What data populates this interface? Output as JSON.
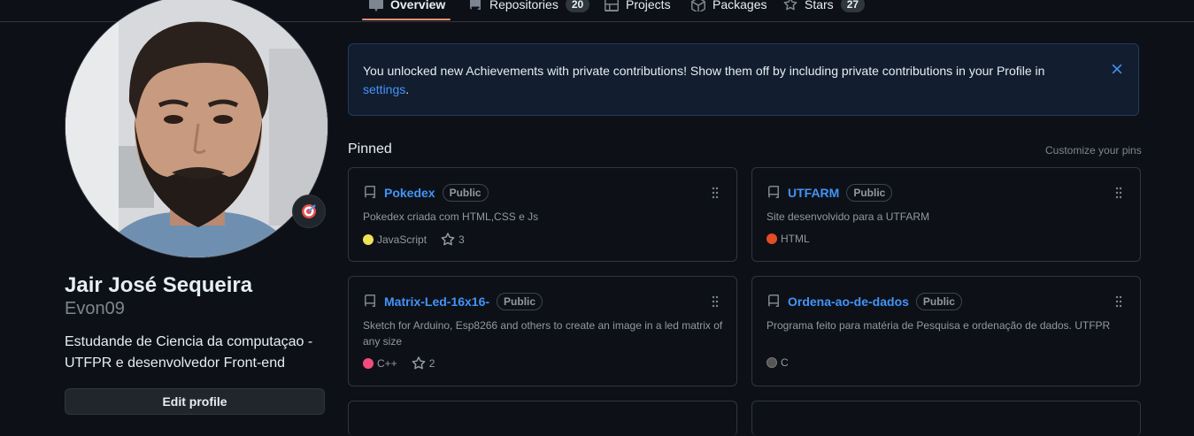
{
  "nav": {
    "tabs": [
      {
        "label": "Overview",
        "icon": "book-icon",
        "selected": true
      },
      {
        "label": "Repositories",
        "icon": "repo-icon",
        "count": "20"
      },
      {
        "label": "Projects",
        "icon": "table-icon"
      },
      {
        "label": "Packages",
        "icon": "package-icon"
      },
      {
        "label": "Stars",
        "icon": "star-icon",
        "count": "27"
      }
    ]
  },
  "profile": {
    "full_name": "Jair José Sequeira",
    "username": "Evon09",
    "bio": "Estudande de Ciencia da computaçao - UTFPR e desenvolvedor Front-end",
    "edit_label": "Edit profile",
    "status_icon": "target-emoji-icon"
  },
  "banner": {
    "text": "You unlocked new Achievements with private contributions! Show them off by including private contributions in your Profile in ",
    "link": "settings",
    "end": "."
  },
  "pinned": {
    "title": "Pinned",
    "customize": "Customize your pins",
    "repos": [
      {
        "name": "Pokedex",
        "visibility": "Public",
        "description": "Pokedex criada com HTML,CSS e Js",
        "language": "JavaScript",
        "language_color": "#f1e05a",
        "stars": "3"
      },
      {
        "name": "UTFARM",
        "visibility": "Public",
        "description": "Site desenvolvido para a UTFARM",
        "language": "HTML",
        "language_color": "#e34c26",
        "stars": ""
      },
      {
        "name": "Matrix-Led-16x16-",
        "visibility": "Public",
        "description": "Sketch for Arduino, Esp8266 and others to create an image in a led matrix of any size",
        "language": "C++",
        "language_color": "#f34b7d",
        "stars": "2"
      },
      {
        "name": "Ordena-ao-de-dados",
        "visibility": "Public",
        "description": "Programa feito para matéria de Pesquisa e ordenação de dados. UTFPR",
        "language": "C",
        "language_color": "#555555",
        "stars": ""
      }
    ]
  },
  "colors": {
    "background": "#0d1117",
    "accent_link": "#4493f8",
    "tab_underline": "#fd8c73",
    "border": "#30363d"
  }
}
